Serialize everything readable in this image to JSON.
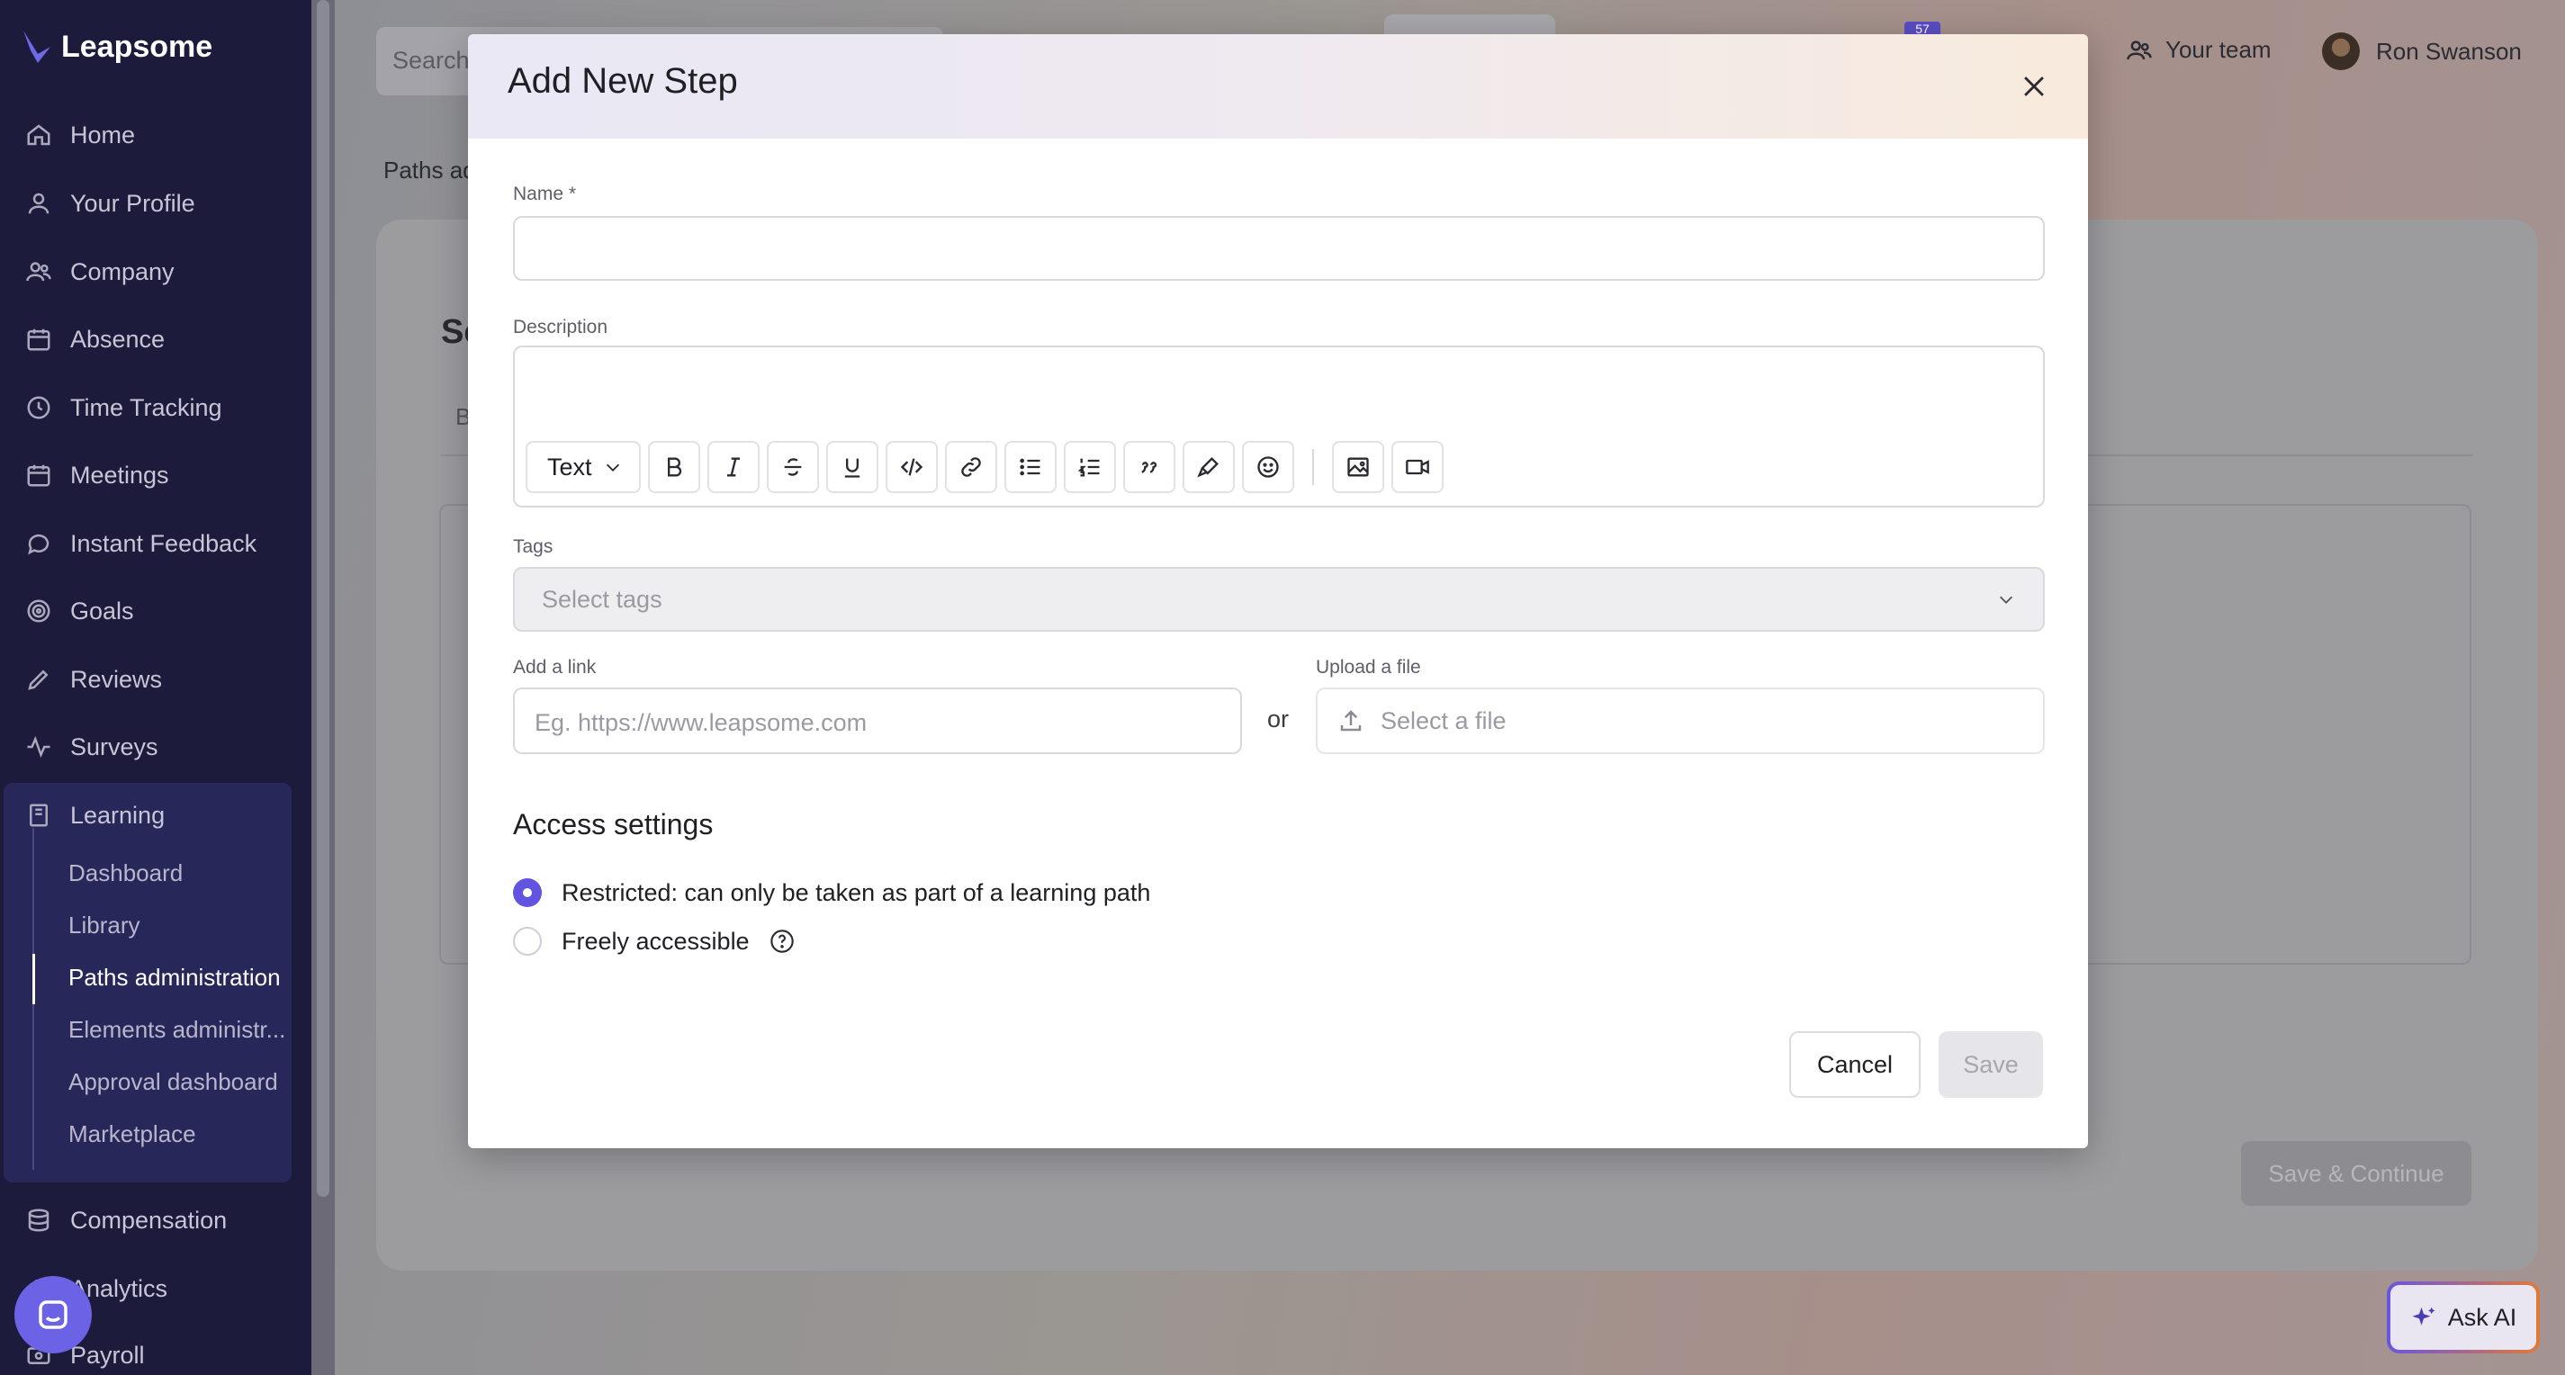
{
  "app": {
    "logo_text": "Leapsome"
  },
  "sidebar": {
    "items": [
      {
        "label": "Home",
        "icon": "home-icon"
      },
      {
        "label": "Your Profile",
        "icon": "user-icon"
      },
      {
        "label": "Company",
        "icon": "users-icon"
      },
      {
        "label": "Absence",
        "icon": "calendar-icon"
      },
      {
        "label": "Time Tracking",
        "icon": "clock-icon"
      },
      {
        "label": "Meetings",
        "icon": "calendar-icon"
      },
      {
        "label": "Instant Feedback",
        "icon": "chat-icon"
      },
      {
        "label": "Goals",
        "icon": "target-icon"
      },
      {
        "label": "Reviews",
        "icon": "pencil-icon"
      },
      {
        "label": "Surveys",
        "icon": "pulse-icon"
      },
      {
        "label": "Learning",
        "icon": "book-icon"
      }
    ],
    "learning_sub": [
      "Dashboard",
      "Library",
      "Paths administration",
      "Elements administr...",
      "Approval dashboard",
      "Marketplace"
    ],
    "after_items": [
      {
        "label": "Compensation",
        "icon": "coins-icon"
      },
      {
        "label": "Analytics",
        "icon": "chart-icon"
      },
      {
        "label": "Payroll",
        "icon": "payroll-icon"
      }
    ]
  },
  "header": {
    "search_placeholder": "Search",
    "badge": "57",
    "team_label": "Your team",
    "user_name": "Ron Swanson"
  },
  "background": {
    "breadcrumb": "Paths ad",
    "card_title": "Se",
    "card_tab": "B",
    "save_continue": "Save & Continue",
    "ask_ai": "Ask AI"
  },
  "modal": {
    "title": "Add New Step",
    "name_label": "Name *",
    "name_value": "",
    "description_label": "Description",
    "toolbar_text_style": "Text",
    "tags_label": "Tags",
    "tags_placeholder": "Select tags",
    "link_label": "Add a link",
    "link_placeholder": "Eg. https://www.leapsome.com",
    "or_text": "or",
    "upload_label": "Upload a file",
    "upload_placeholder": "Select a file",
    "access_title": "Access settings",
    "access_options": [
      {
        "label": "Restricted: can only be taken as part of a learning path",
        "selected": true
      },
      {
        "label": "Freely accessible",
        "selected": false
      }
    ],
    "cancel_label": "Cancel",
    "save_label": "Save"
  },
  "colors": {
    "accent": "#6253e1",
    "sidebar_bg": "#1c1b3c"
  }
}
